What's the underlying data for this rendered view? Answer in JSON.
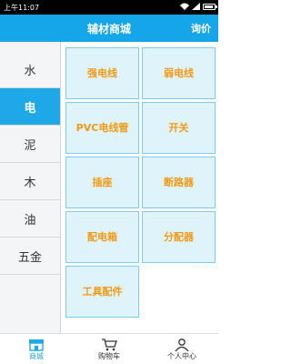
{
  "status_bar": {
    "time": "上午11:07"
  },
  "header": {
    "title": "辅材商城",
    "action": "询价"
  },
  "sidebar": {
    "items": [
      {
        "label": "水"
      },
      {
        "label": "电"
      },
      {
        "label": "泥"
      },
      {
        "label": "木"
      },
      {
        "label": "油"
      },
      {
        "label": "五金"
      }
    ],
    "active_index": 1
  },
  "products": {
    "tiles": [
      {
        "label": "强电线"
      },
      {
        "label": "弱电线"
      },
      {
        "label": "PVC电线管"
      },
      {
        "label": "开关"
      },
      {
        "label": "插座"
      },
      {
        "label": "断路器"
      },
      {
        "label": "配电箱"
      },
      {
        "label": "分配器"
      },
      {
        "label": "工具配件"
      }
    ]
  },
  "tabbar": {
    "items": [
      {
        "label": "商城",
        "icon": "store-icon",
        "active": true
      },
      {
        "label": "购物车",
        "icon": "cart-icon",
        "active": false
      },
      {
        "label": "个人中心",
        "icon": "user-icon",
        "active": false
      }
    ]
  },
  "colors": {
    "accent": "#14a6e8",
    "tile_bg": "#dff3fb",
    "tile_border": "#7ccdf0",
    "tile_text": "#f39a14"
  }
}
